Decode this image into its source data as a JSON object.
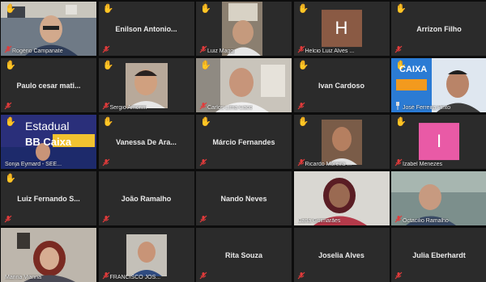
{
  "colors": {
    "tile_bg": "#2b2b2b",
    "active_border": "#b7e05a",
    "hand_color": "#f5c542",
    "mic_muted": "#e23b3b",
    "avatar_h": "#8a5a44",
    "avatar_i": "#e95aa6"
  },
  "participants": [
    {
      "name": "Rogério Campanate",
      "type": "video",
      "hand": true,
      "muted": true
    },
    {
      "name": "Enilson  Antonio...",
      "type": "name",
      "hand": true,
      "muted": true
    },
    {
      "name": "Luiz Maggi",
      "type": "video",
      "hand": true,
      "muted": true
    },
    {
      "name": "Helcio Luiz Alves ...",
      "type": "avatar",
      "avatar_letter": "H",
      "hand": true,
      "muted": true
    },
    {
      "name": "Arrizon Filho",
      "type": "name",
      "hand": true,
      "muted": true
    },
    {
      "name": "Paulo cesar mati...",
      "type": "name",
      "hand": true,
      "muted": true
    },
    {
      "name": "Sergio Amorim",
      "type": "video",
      "hand": true,
      "muted": true
    },
    {
      "name": "Carlos Lima Caco",
      "type": "video",
      "hand": true,
      "muted": true
    },
    {
      "name": "Ivan Cardoso",
      "type": "name",
      "hand": true,
      "muted": true
    },
    {
      "name": "José Ferreira Pinto",
      "type": "video",
      "hand": true,
      "muted": false,
      "pinned": true,
      "overlay_text": "CAIXA"
    },
    {
      "name": "Sonja Eymard - SEE...",
      "type": "video",
      "hand": true,
      "muted": false,
      "overlay_text": "Estadual",
      "overlay_text2": "BB Caixa"
    },
    {
      "name": "Vanessa De Ara...",
      "type": "name",
      "hand": true,
      "muted": true
    },
    {
      "name": "Márcio Fernandes",
      "type": "name",
      "hand": true,
      "muted": true
    },
    {
      "name": "Ricardo Moreira ...",
      "type": "video",
      "hand": true,
      "muted": true
    },
    {
      "name": "Izabel Menezes",
      "type": "avatar",
      "avatar_letter": "I",
      "hand": true,
      "muted": true
    },
    {
      "name": "Luiz Fernando S...",
      "type": "name",
      "hand": true,
      "muted": true
    },
    {
      "name": "João Ramalho",
      "type": "name",
      "hand": false,
      "muted": true
    },
    {
      "name": "Nando Neves",
      "type": "name",
      "hand": false,
      "muted": true
    },
    {
      "name": "Carla Guimarães",
      "type": "video",
      "hand": false,
      "muted": false,
      "active": true
    },
    {
      "name": "Octacilio Ramalho",
      "type": "video",
      "hand": false,
      "muted": true
    },
    {
      "name": "Marina Vianna",
      "type": "video",
      "hand": false,
      "muted": false
    },
    {
      "name": "FRANCISCO JOS...",
      "type": "video",
      "hand": false,
      "muted": true
    },
    {
      "name": "Rita Souza",
      "type": "name",
      "hand": false,
      "muted": true
    },
    {
      "name": "Joselia Alves",
      "type": "name",
      "hand": false,
      "muted": true
    },
    {
      "name": "Julia Eberhardt",
      "type": "name",
      "hand": false,
      "muted": true
    }
  ]
}
